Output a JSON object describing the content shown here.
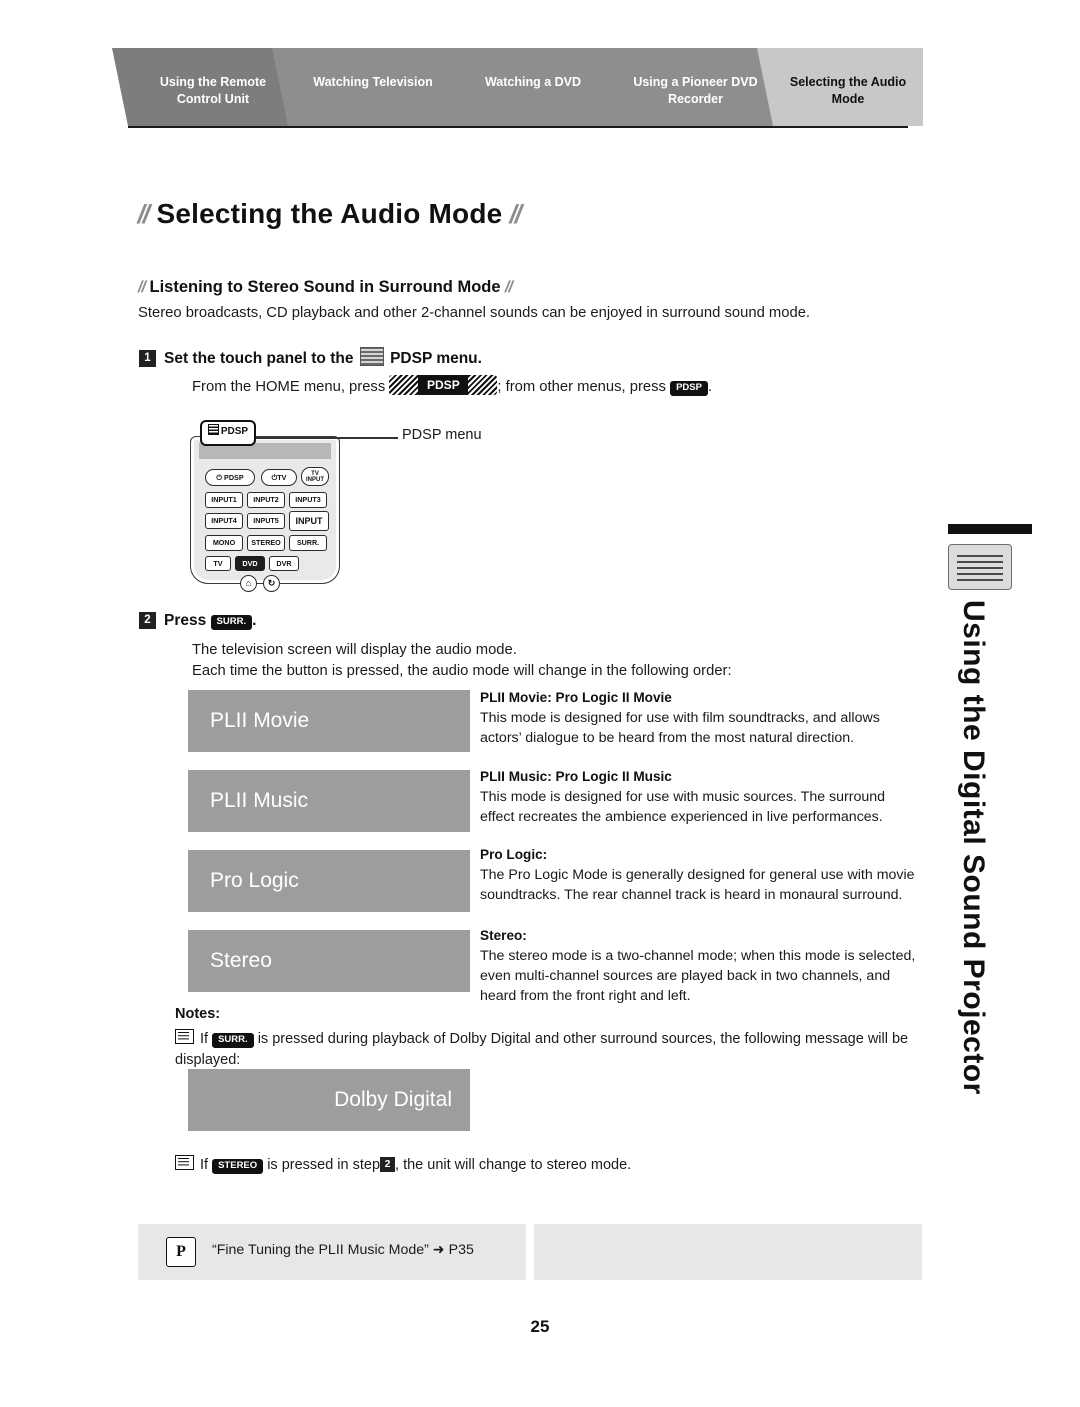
{
  "tabs": [
    {
      "line1": "Using the Remote",
      "line2": "Control Unit"
    },
    {
      "line1": "Watching Television",
      "line2": ""
    },
    {
      "line1": "Watching a DVD",
      "line2": ""
    },
    {
      "line1": "Using a Pioneer DVD",
      "line2": "Recorder"
    },
    {
      "line1": "Selecting the Audio",
      "line2": "Mode"
    }
  ],
  "page": {
    "title": "Selecting the Audio Mode",
    "subhead": "Listening to Stereo Sound in Surround Mode",
    "intro": "Stereo broadcasts, CD playback and other 2-channel sounds can be enjoyed in surround sound mode.",
    "number": "25"
  },
  "steps": [
    {
      "num": "1",
      "head_before": "Set the touch panel to the",
      "head_after": "PDSP menu.",
      "body_1": "From the HOME menu, press",
      "body_2": "; from other menus, press",
      "body_3": ".",
      "key_hatch": "PDSP",
      "key_plain": "PDSP"
    },
    {
      "num": "2",
      "head_before": "Press",
      "head_key": "SURR.",
      "head_after": ".",
      "body_line1": "The television screen will display the audio mode.",
      "body_line2": "Each time the button is pressed, the audio mode will change in the following order:"
    }
  ],
  "remote": {
    "pdsp_tab_label": "PDSP",
    "callout_label": "PDSP menu",
    "buttons": [
      "PDSP",
      "TV",
      "TV INPUT",
      "INPUT1",
      "INPUT2",
      "INPUT3",
      "INPUT4",
      "INPUT5",
      "INPUT",
      "MONO",
      "STEREO",
      "SURR.",
      "TV",
      "DVD",
      "DVR"
    ]
  },
  "modes": [
    {
      "label": "PLII Movie",
      "desc_head": "PLII Movie: Pro Logic II Movie",
      "desc_body": "This mode is designed for use with film soundtracks, and allows actors’ dialogue to be heard from the most natural direction."
    },
    {
      "label": "PLII Music",
      "desc_head": "PLII Music: Pro Logic II Music",
      "desc_body": "This mode is designed for use with music sources. The surround effect recreates the ambience experienced in live performances."
    },
    {
      "label": "Pro Logic",
      "desc_head": "Pro Logic:",
      "desc_body": "The Pro Logic Mode is generally designed for general use with movie soundtracks. The rear channel track is heard in monaural surround."
    },
    {
      "label": "Stereo",
      "desc_head": "Stereo:",
      "desc_body": "The stereo mode is a two-channel mode; when this mode is selected, even multi-channel sources are played back in two channels, and heard from the front right and left."
    }
  ],
  "notes": {
    "label": "Notes:",
    "note1_before": "If",
    "note1_key": "SURR.",
    "note1_after": "is pressed during playback of Dolby Digital and other surround sources, the following message will be displayed:",
    "dolby_block": "Dolby Digital",
    "note2_before": "If",
    "note2_key": "STEREO",
    "note2_mid": "is pressed in step",
    "note2_stepnum": "2",
    "note2_after": ", the unit will change to stereo mode."
  },
  "side_title": "Using the Digital Sound Projector",
  "references": [
    {
      "icon": "P",
      "text": "“Fine Tuning the PLII Music Mode” ➜ P35"
    },
    {
      "icon": "",
      "text": ""
    }
  ]
}
